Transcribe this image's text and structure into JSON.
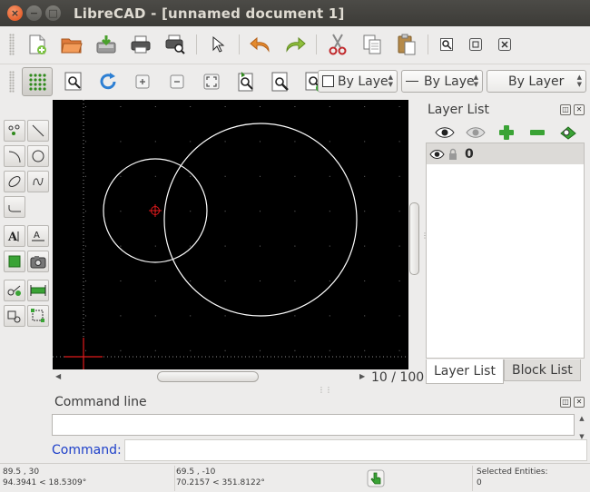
{
  "window": {
    "title": "LibreCAD - [unnamed document 1]",
    "close_glyph": "×",
    "minimize_glyph": "−",
    "maximize_glyph": "□"
  },
  "toolbar": {
    "pen_color_combo": "By Laye",
    "line_type_combo": "By Laye",
    "line_width_combo": "By Layer"
  },
  "drawing": {
    "grid_info": "10 / 100"
  },
  "layer_list": {
    "title": "Layer List",
    "layers": [
      {
        "name": "0"
      }
    ],
    "tabs": [
      "Layer List",
      "Block List"
    ]
  },
  "command": {
    "dock_title": "Command line",
    "label": "Command:"
  },
  "status": {
    "abs_coord": "89.5 , 30",
    "abs_polar": "94.3941 < 18.5309°",
    "rel_coord": "69.5 , -10",
    "rel_polar": "70.2157 < 351.8122°",
    "selected_label": "Selected Entities:",
    "selected_count": "0"
  },
  "colors": {
    "canvas": "#000000",
    "crosshair": "#e0191b",
    "entity": "#ffffff",
    "command_label": "#1d3fc9"
  }
}
